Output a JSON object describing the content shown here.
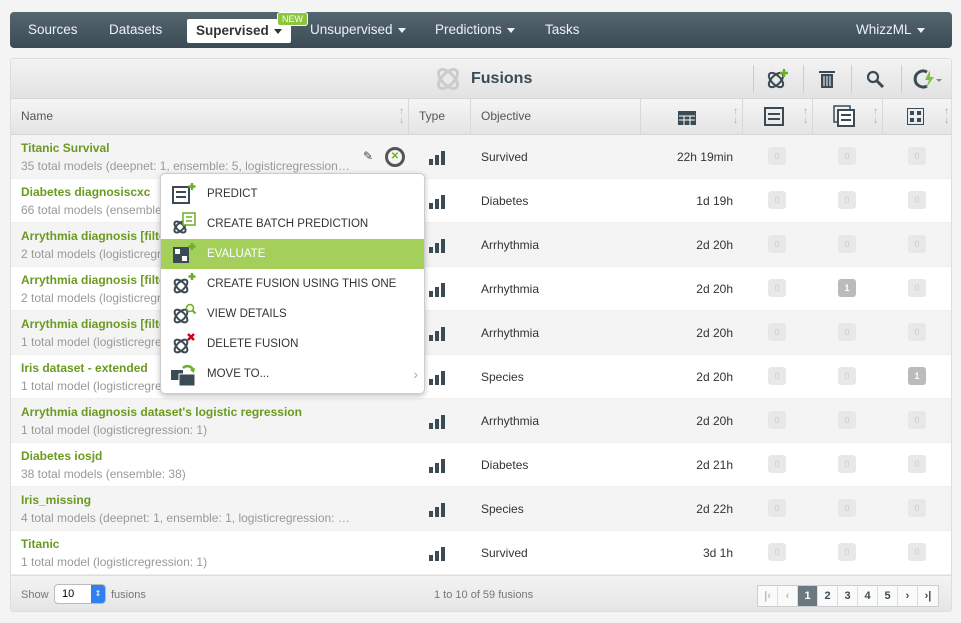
{
  "nav": {
    "items": [
      "Sources",
      "Datasets",
      "Supervised",
      "Unsupervised",
      "Predictions",
      "Tasks"
    ],
    "new_badge": "NEW",
    "user": "WhizzML"
  },
  "title": "Fusions",
  "columns": {
    "name": "Name",
    "type": "Type",
    "objective": "Objective"
  },
  "rows": [
    {
      "name": "Titanic Survival",
      "sub": "35 total models (deepnet: 1, ensemble: 5, logisticregression: …",
      "objective": "Survived",
      "age": "22h 19min",
      "pred": "0",
      "batch": "0",
      "eval": "0"
    },
    {
      "name": "Diabetes diagnosiscxc",
      "sub": "66 total models (ensemble: 66)",
      "objective": "Diabetes",
      "age": "1d 19h",
      "pred": "0",
      "batch": "0",
      "eval": "0"
    },
    {
      "name": "Arrythmia diagnosis [filtered]",
      "sub": "2 total models (logisticregression: 2)",
      "objective": "Arrhythmia",
      "age": "2d 20h",
      "pred": "0",
      "batch": "0",
      "eval": "0"
    },
    {
      "name": "Arrythmia diagnosis [filtered]",
      "sub": "2 total models (logisticregression: 2)",
      "objective": "Arrhythmia",
      "age": "2d 20h",
      "pred": "0",
      "batch": "1",
      "eval": "0"
    },
    {
      "name": "Arrythmia diagnosis [filtered]",
      "sub": "1 total model (logisticregression: 1)",
      "objective": "Arrhythmia",
      "age": "2d 20h",
      "pred": "0",
      "batch": "0",
      "eval": "0"
    },
    {
      "name": "Iris dataset - extended",
      "sub": "1 total model (logisticregression: 1)",
      "objective": "Species",
      "age": "2d 20h",
      "pred": "0",
      "batch": "0",
      "eval": "1"
    },
    {
      "name": "Arrythmia diagnosis dataset's logistic regression",
      "sub": "1 total model (logisticregression: 1)",
      "objective": "Arrhythmia",
      "age": "2d 20h",
      "pred": "0",
      "batch": "0",
      "eval": "0"
    },
    {
      "name": "Diabetes iosjd",
      "sub": "38 total models (ensemble: 38)",
      "objective": "Diabetes",
      "age": "2d 21h",
      "pred": "0",
      "batch": "0",
      "eval": "0"
    },
    {
      "name": "Iris_missing",
      "sub": "4 total models (deepnet: 1, ensemble: 1, logisticregression: 1…",
      "objective": "Species",
      "age": "2d 22h",
      "pred": "0",
      "batch": "0",
      "eval": "0"
    },
    {
      "name": "Titanic",
      "sub": "1 total model (logisticregression: 1)",
      "objective": "Survived",
      "age": "3d 1h",
      "pred": "0",
      "batch": "0",
      "eval": "0"
    }
  ],
  "menu": [
    {
      "label": "PREDICT",
      "icon": "predict-icon"
    },
    {
      "label": "CREATE BATCH PREDICTION",
      "icon": "batch-prediction-icon"
    },
    {
      "label": "EVALUATE",
      "icon": "evaluate-icon",
      "highlighted": true
    },
    {
      "label": "CREATE FUSION USING THIS ONE",
      "icon": "create-fusion-icon"
    },
    {
      "label": "VIEW DETAILS",
      "icon": "view-details-icon"
    },
    {
      "label": "DELETE FUSION",
      "icon": "delete-fusion-icon"
    },
    {
      "label": "MOVE TO...",
      "icon": "move-folder-icon",
      "submenu": true
    }
  ],
  "footer": {
    "show": "Show",
    "page_size": "10",
    "unit": "fusions",
    "summary": "1 to 10 of 59 fusions",
    "pages": [
      "1",
      "2",
      "3",
      "4",
      "5"
    ],
    "current_page": "1"
  },
  "colors": {
    "accent": "#8cc63f",
    "nav": "#3b4b55",
    "link": "#6a9a1f",
    "highlight": "#a3cf5a"
  }
}
